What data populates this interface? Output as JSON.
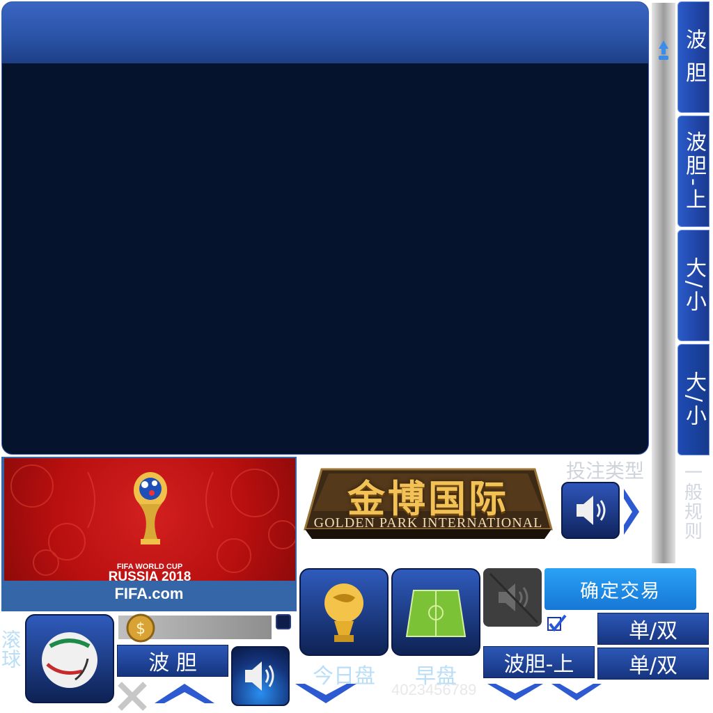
{
  "right_tabs": [
    "波 胆",
    "波胆-上",
    "大/小",
    "大/小"
  ],
  "right_label": "一般规则",
  "banner": {
    "line1": "FIFA WORLD CUP",
    "line2": "RUSSIA 2018",
    "footer": "FIFA.com"
  },
  "logo": {
    "cn": "金博国际",
    "en": "GOLDEN PARK INTERNATIONAL"
  },
  "bet_type_label": "投注类型",
  "confirm_trade": "确定交易",
  "odd_even_1": "单/双",
  "odd_even_2": "单/双",
  "btn_bodan": "波 胆",
  "btn_bodan_up": "波胆-上",
  "label_rolling": "滚球",
  "label_today": "今日盘",
  "label_early": "早盘",
  "digits": "4023456789",
  "colors": {
    "accent_blue": "#2146a8",
    "panel_dark": "#06132c",
    "confirm": "#1b8de6"
  }
}
